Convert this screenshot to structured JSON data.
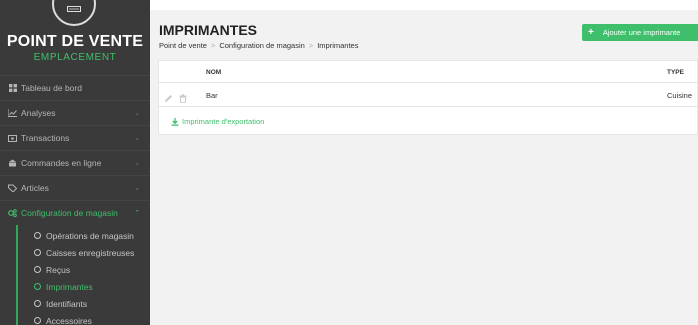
{
  "brand": {
    "title": "POINT DE VENTE",
    "subtitle": "EMPLACEMENT"
  },
  "nav": [
    {
      "label": "Tableau de bord",
      "icon": "dashboard-icon"
    },
    {
      "label": "Analyses",
      "icon": "chart-icon"
    },
    {
      "label": "Transactions",
      "icon": "transactions-icon"
    },
    {
      "label": "Commandes en ligne",
      "icon": "online-orders-icon"
    },
    {
      "label": "Articles",
      "icon": "tag-icon"
    },
    {
      "label": "Configuration de magasin",
      "icon": "cogs-icon"
    }
  ],
  "submenu": [
    {
      "label": "Opérations de magasin"
    },
    {
      "label": "Caisses enregistreuses"
    },
    {
      "label": "Reçus"
    },
    {
      "label": "Imprimantes"
    },
    {
      "label": "Identifiants"
    },
    {
      "label": "Accessoires"
    }
  ],
  "page": {
    "title": "IMPRIMANTES",
    "breadcrumb": [
      "Point de vente",
      "Configuration de magasin",
      "Imprimantes"
    ],
    "add_button": "Ajouter une imprimante"
  },
  "table": {
    "columns": [
      "NOM",
      "TYPE"
    ],
    "rows": [
      {
        "name": "Bar",
        "type": "Cuisine"
      }
    ]
  },
  "export_link": "Imprimante d'exportation",
  "colors": {
    "accent": "#3fbf6c",
    "sidebar": "#3a3a3a"
  }
}
